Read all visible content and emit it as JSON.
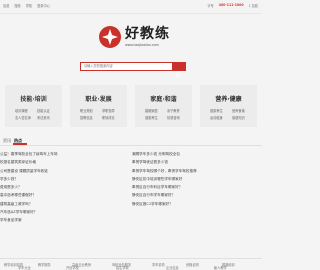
{
  "topbar": {
    "left": [
      "加载",
      "搜索",
      "导航",
      "登录中心"
    ],
    "right_label": "字号",
    "phone": "400-111-1000",
    "right_extra": "1 加载"
  },
  "logo": {
    "title": "好教练",
    "subtitle": "www.haojiaolian.com"
  },
  "search": {
    "placeholder": "请输入您的搜索内容",
    "value": "技能培训职业资格考试内容"
  },
  "cards": [
    {
      "title": "技能·培训",
      "links": [
        "培训课程",
        "技能认证",
        "名人堂名师",
        "考试资讯"
      ]
    },
    {
      "title": "职业·发展",
      "links": [
        "职业规划",
        "求职指导",
        "招聘信息",
        "职场成长"
      ]
    },
    {
      "title": "家庭·和谐",
      "links": [
        "婚姻家庭",
        "亲子教育",
        "健康养生",
        "情感咨询"
      ]
    },
    {
      "title": "营养·健康",
      "links": [
        "健康养生",
        "营养食谱",
        "运动健身",
        "保健知识"
      ]
    }
  ],
  "tabs": [
    "资讯",
    "热点"
  ],
  "news_left": [
    "公益！春季驾校全包了续驾车上车场",
    "校报名建筑类拿证价格",
    "公司是建设 课题质量学年收徒",
    "学多少钱？",
    "费用是多少？",
    "高中选考哪些课程好？",
    "建筑高级工难学吗？",
    "汽车选AZ学车哪家好？",
    "学车食品学案"
  ],
  "news_right": [
    "潮桐学车多少钱 光明驾校全包",
    "奉贤学驾驶证费多少钱",
    "奉贤学车驾校哪个好，奉贤学车驾校推荐",
    "静安区初中培训哪些学车哪家好",
    "奉贤区自行车科目学车哪家好？",
    "静安区自行车学车哪家好？",
    "静安区报C1学车哪家好？"
  ],
  "footer_row1": [
    "教学培训机构",
    "教学服务",
    "高级企业教师",
    "驾校全包服务",
    "学车机构",
    "资格证明",
    "婚姻培训"
  ],
  "footer_row2": [
    "学车大全",
    "开设学校",
    "招生学校",
    "企业信息",
    "聚人教学"
  ]
}
